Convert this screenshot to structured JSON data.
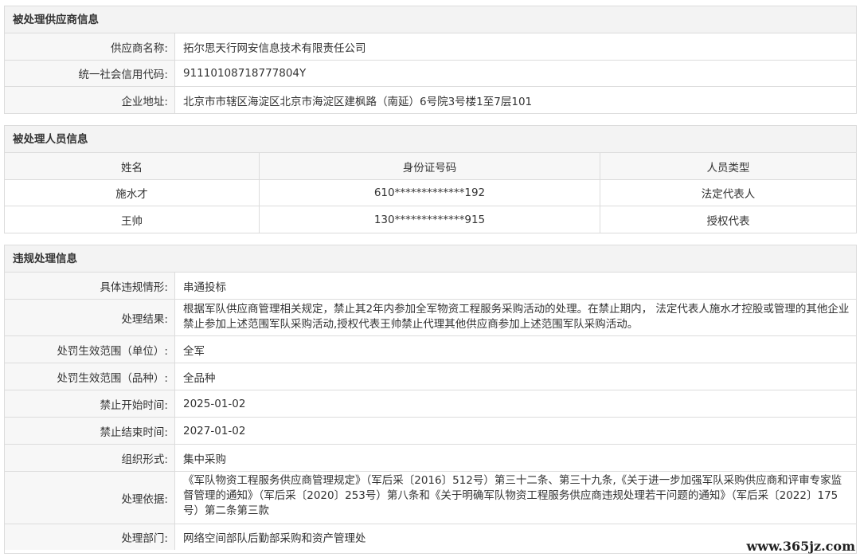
{
  "supplier": {
    "section_title": "被处理供应商信息",
    "rows": [
      {
        "label": "供应商名称:",
        "value": "拓尔思天行网安信息技术有限责任公司"
      },
      {
        "label": "统一社会信用代码:",
        "value": "91110108718777804Y"
      },
      {
        "label": "企业地址:",
        "value": "北京市市辖区海淀区北京市海淀区建枫路（南延）6号院3号楼1至7层101"
      }
    ]
  },
  "persons": {
    "section_title": "被处理人员信息",
    "headers": [
      "姓名",
      "身份证号码",
      "人员类型"
    ],
    "rows": [
      [
        "施水才",
        "610*************192",
        "法定代表人"
      ],
      [
        "王帅",
        "130*************915",
        "授权代表"
      ]
    ]
  },
  "violation": {
    "section_title": "违规处理信息",
    "rows": [
      {
        "label": "具体违规情形:",
        "value": "串通投标"
      },
      {
        "label": "处理结果:",
        "value": "根据军队供应商管理相关规定，禁止其2年内参加全军物资工程服务采购活动的处理。在禁止期内， 法定代表人施水才控股或管理的其他企业禁止参加上述范围军队采购活动,授权代表王帅禁止代理其他供应商参加上述范围军队采购活动。"
      },
      {
        "label": "处罚生效范围（单位）:",
        "value": "全军"
      },
      {
        "label": "处罚生效范围（品种）:",
        "value": "全品种"
      },
      {
        "label": "禁止开始时间:",
        "value": "2025-01-02"
      },
      {
        "label": "禁止结束时间:",
        "value": "2027-01-02"
      },
      {
        "label": "组织形式:",
        "value": "集中采购"
      },
      {
        "label": "处理依据:",
        "value": "《军队物资工程服务供应商管理规定》（军后采〔2016〕512号）第三十二条、第三十九条,《关于进一步加强军队采购供应商和评审专家监督管理的通知》（军后采〔2020〕253号）第八条和《关于明确军队物资工程服务供应商违规处理若干问题的通知》（军后采〔2022〕175号）第二条第三款"
      },
      {
        "label": "处理部门:",
        "value": "网络空间部队后勤部采购和资产管理处"
      }
    ]
  },
  "watermark": "www.365jz.com"
}
